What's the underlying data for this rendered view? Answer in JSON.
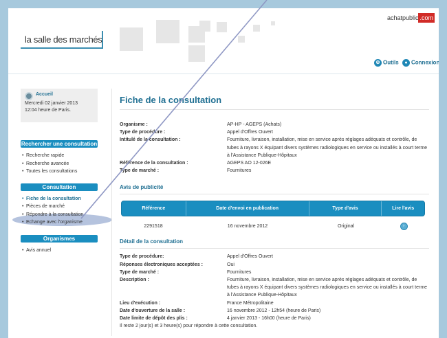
{
  "header": {
    "logo_text": "la salle des marchés",
    "brand_prefix": "achatpublic",
    "brand_suffix": ".com",
    "links": [
      {
        "label": "Outils",
        "icon": "tools-icon"
      },
      {
        "label": "Connexion",
        "icon": "user-icon"
      }
    ]
  },
  "sidebar": {
    "accueil": {
      "title": "Accueil",
      "date_line": "Mercredi 02 janvier 2013",
      "time_line": "12:04 heure de Paris."
    },
    "sections": [
      {
        "title": "Rechercher une consultation",
        "items": [
          "Recherche rapide",
          "Recherche avancée",
          "Toutes les consultations"
        ]
      },
      {
        "title": "Consultation",
        "items": [
          "Fiche de la consultation",
          "Pièces de marché",
          "Répondre à la consultation",
          "Echange avec l'organisme"
        ]
      },
      {
        "title": "Organismes",
        "items": [
          "Avis annuel"
        ]
      }
    ]
  },
  "main": {
    "title": "Fiche de la consultation",
    "info": [
      {
        "label": "Organisme :",
        "value": "AP-HP - AGEPS (Achats)"
      },
      {
        "label": "Type de procédure :",
        "value": "Appel d'Offres Ouvert"
      },
      {
        "label": "Intitulé de la consultation :",
        "value": "Fourniture, livraison, installation, mise en service après réglages adéquats et contrôle, de tubes à rayons X équipant divers systèmes radiologiques en service ou installés à court terme à l'Assistance Publique-Hôpitaux"
      },
      {
        "label": "Référence de la consultation :",
        "value": "AGEPS AO 12-026E"
      },
      {
        "label": "Type de marché :",
        "value": "Fournitures"
      }
    ],
    "avis_title": "Avis de publicité",
    "table": {
      "headers": [
        "Référence",
        "Date d'envoi en publication",
        "Type d'avis",
        "Lire l'avis"
      ],
      "rows": [
        {
          "reference": "2291518",
          "date": "16 novembre 2012",
          "type": "Original"
        }
      ]
    },
    "detail_title": "Détail de la consultation",
    "detail": [
      {
        "label": "Type de procédure:",
        "value": "Appel d'Offres Ouvert"
      },
      {
        "label": "Réponses électroniques acceptées :",
        "value": "Oui"
      },
      {
        "label": "Type de marché :",
        "value": "Fournitures"
      },
      {
        "label": "Description :",
        "value": "Fourniture, livraison, installation, mise en service après réglages adéquats et contrôle, de tubes à rayons X équipant divers systèmes radiologiques en service ou installés à court terme à l'Assistance Publique-Hôpitaux"
      },
      {
        "label": "Lieu d'exécution :",
        "value": "France Métropolitaine"
      },
      {
        "label": "Date d'ouverture de la salle :",
        "value": "16 novembre 2012 - 12h54 (heure de Paris)"
      },
      {
        "label": "Date limite de dépôt des plis :",
        "value": "4 janvier 2013 - 16h00 (heure de Paris)"
      }
    ],
    "remaining": "Il reste 2 jour(s) et 3 heure(s) pour répondre à cette consultation."
  },
  "colors": {
    "accent": "#1a8ec0",
    "title": "#1f6f92",
    "brand_red": "#d12b27",
    "background": "#a7c9dd"
  }
}
